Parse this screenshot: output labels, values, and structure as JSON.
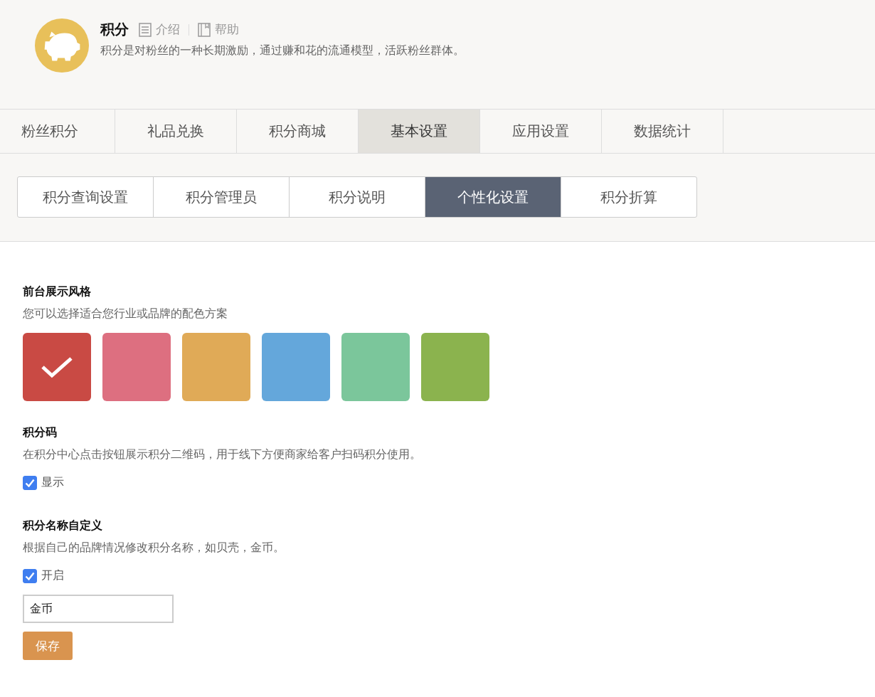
{
  "header": {
    "title": "积分",
    "links": [
      {
        "kind": "intro",
        "label": "介绍"
      },
      {
        "kind": "help",
        "label": "帮助"
      }
    ],
    "description": "积分是对粉丝的一种长期激励，通过赚和花的流通模型，活跃粉丝群体。"
  },
  "tabs": [
    {
      "label": "粉丝积分",
      "selected": false
    },
    {
      "label": "礼品兑换",
      "selected": false
    },
    {
      "label": "积分商城",
      "selected": false
    },
    {
      "label": "基本设置",
      "selected": true
    },
    {
      "label": "应用设置",
      "selected": false
    },
    {
      "label": "数据统计",
      "selected": false
    }
  ],
  "subtabs": [
    {
      "label": "积分查询设置",
      "selected": false
    },
    {
      "label": "积分管理员",
      "selected": false
    },
    {
      "label": "积分说明",
      "selected": false
    },
    {
      "label": "个性化设置",
      "selected": true
    },
    {
      "label": "积分折算",
      "selected": false
    }
  ],
  "style_section": {
    "title": "前台展示风格",
    "description": "您可以选择适合您行业或品牌的配色方案",
    "swatches": [
      {
        "color": "#c94a44",
        "selected": true
      },
      {
        "color": "#dd6f80",
        "selected": false
      },
      {
        "color": "#e0aa57",
        "selected": false
      },
      {
        "color": "#64a7db",
        "selected": false
      },
      {
        "color": "#7bc69b",
        "selected": false
      },
      {
        "color": "#8bb34e",
        "selected": false
      }
    ]
  },
  "qrcode_section": {
    "title": "积分码",
    "description": "在积分中心点击按钮展示积分二维码，用于线下方便商家给客户扫码积分使用。",
    "checkbox": {
      "label": "显示",
      "checked": true
    }
  },
  "name_section": {
    "title": "积分名称自定义",
    "description": "根据自己的品牌情况修改积分名称，如贝壳，金币。",
    "checkbox": {
      "label": "开启",
      "checked": true
    },
    "input": {
      "value": "金币"
    }
  },
  "save_button": "保存"
}
